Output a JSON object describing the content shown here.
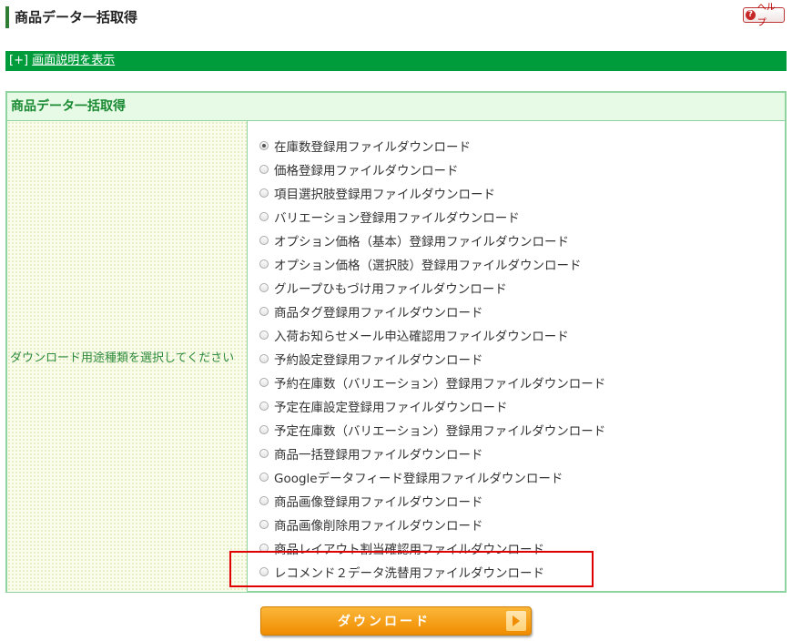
{
  "header": {
    "title": "商品データ一括取得",
    "help_label": "ヘルプ",
    "help_icon": "?"
  },
  "explain_bar": {
    "toggle": "[+]",
    "link_label": "画面説明を表示"
  },
  "panel": {
    "title": "商品データ一括取得",
    "field_label": "ダウンロード用途種類を選択してください",
    "options": [
      {
        "label": "在庫数登録用ファイルダウンロード",
        "checked": true
      },
      {
        "label": "価格登録用ファイルダウンロード",
        "checked": false
      },
      {
        "label": "項目選択肢登録用ファイルダウンロード",
        "checked": false
      },
      {
        "label": "バリエーション登録用ファイルダウンロード",
        "checked": false
      },
      {
        "label": "オプション価格（基本）登録用ファイルダウンロード",
        "checked": false
      },
      {
        "label": "オプション価格（選択肢）登録用ファイルダウンロード",
        "checked": false
      },
      {
        "label": "グループひもづけ用ファイルダウンロード",
        "checked": false
      },
      {
        "label": "商品タグ登録用ファイルダウンロード",
        "checked": false
      },
      {
        "label": "入荷お知らせメール申込確認用ファイルダウンロード",
        "checked": false
      },
      {
        "label": "予約設定登録用ファイルダウンロード",
        "checked": false
      },
      {
        "label": "予約在庫数（バリエーション）登録用ファイルダウンロード",
        "checked": false
      },
      {
        "label": "予定在庫設定登録用ファイルダウンロード",
        "checked": false
      },
      {
        "label": "予定在庫数（バリエーション）登録用ファイルダウンロード",
        "checked": false
      },
      {
        "label": "商品一括登録用ファイルダウンロード",
        "checked": false
      },
      {
        "label": "Googleデータフィード登録用ファイルダウンロード",
        "checked": false
      },
      {
        "label": "商品画像登録用ファイルダウンロード",
        "checked": false
      },
      {
        "label": "商品画像削除用ファイルダウンロード",
        "checked": false
      },
      {
        "label": "商品レイアウト割当確認用ファイルダウンロード",
        "checked": false
      },
      {
        "label": "レコメンド２データ洗替用ファイルダウンロード",
        "checked": false
      }
    ]
  },
  "download_button": {
    "label": "ダウンロード"
  },
  "colors": {
    "accent_green": "#009c3b",
    "highlight_red": "#e00000",
    "button_orange": "#f08c00"
  }
}
